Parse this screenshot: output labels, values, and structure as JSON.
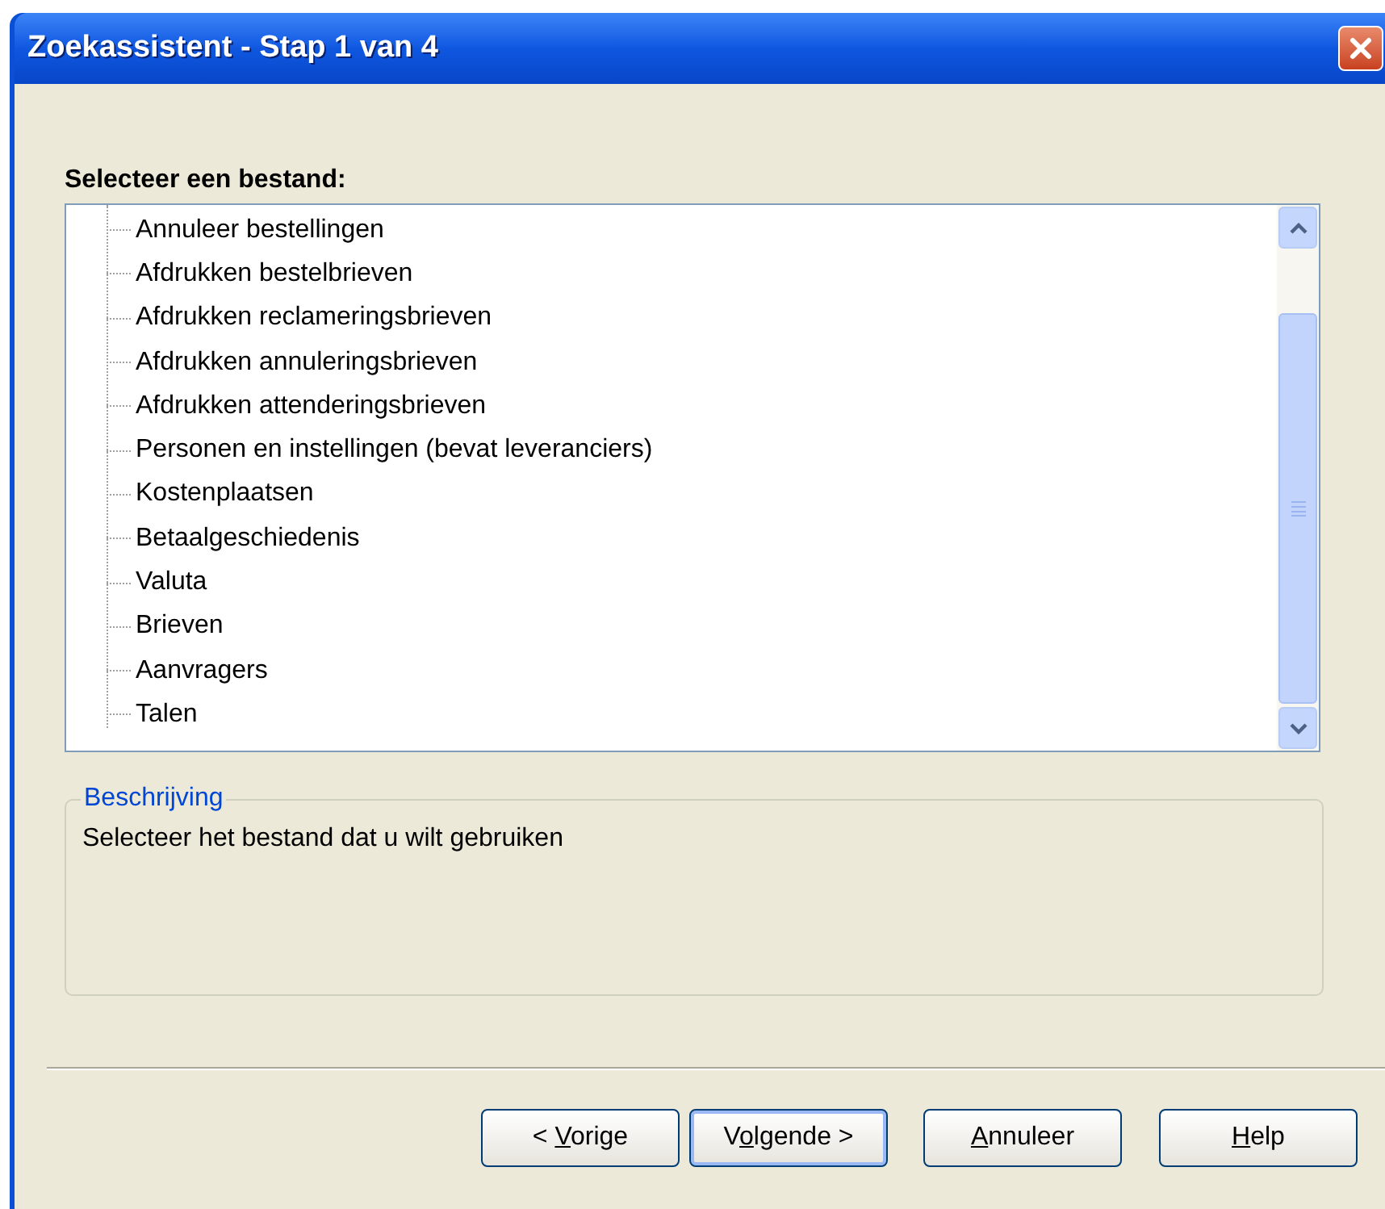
{
  "window": {
    "title": "Zoekassistent - Stap 1 van 4"
  },
  "heading": "Selecteer een bestand:",
  "file_tree": {
    "items": [
      {
        "label": "Annuleer bestellingen",
        "selected": false
      },
      {
        "label": "Afdrukken bestelbrieven",
        "selected": false
      },
      {
        "label": "Afdrukken reclameringsbrieven",
        "selected": false
      },
      {
        "label": "Afdrukken annuleringsbrieven",
        "selected": false
      },
      {
        "label": "Afdrukken attenderingsbrieven",
        "selected": false
      },
      {
        "label": "Personen en instellingen (bevat leveranciers)",
        "selected": false
      },
      {
        "label": "Kostenplaatsen",
        "selected": false
      },
      {
        "label": "Betaalgeschiedenis",
        "selected": false
      },
      {
        "label": "Valuta",
        "selected": false
      },
      {
        "label": "Brieven",
        "selected": false
      },
      {
        "label": "Aanvragers",
        "selected": false
      },
      {
        "label": "Talen",
        "selected": false
      }
    ]
  },
  "description": {
    "legend": "Beschrijving",
    "text": "Selecteer het bestand dat u wilt gebruiken"
  },
  "buttons": [
    {
      "label_before": "< ",
      "access_key": "V",
      "label_after": "orige",
      "default": false
    },
    {
      "label_before": "V",
      "access_key": "o",
      "label_after": "lgende >",
      "default": true
    },
    {
      "access_key": "A",
      "label_after": "nnuleer",
      "default": false
    },
    {
      "access_key": "H",
      "label_after": "elp",
      "default": false
    }
  ]
}
